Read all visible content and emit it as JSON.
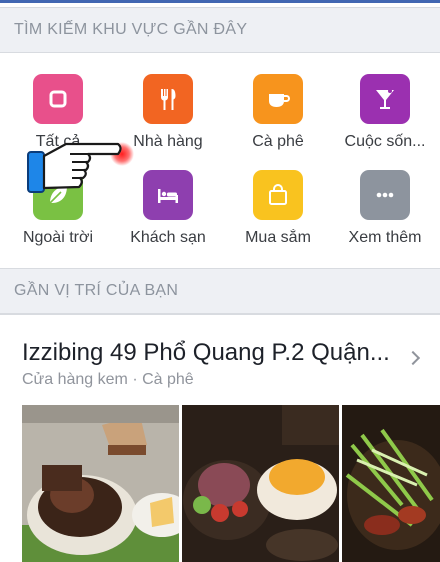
{
  "sections": {
    "nearby_header": "TÌM KIẾM KHU VỰC GẦN ĐÂY",
    "location_header": "GẦN VỊ TRÍ CỦA BẠN"
  },
  "categories": [
    {
      "label": "Tất cả",
      "icon": "all-icon",
      "color": "#e8508b"
    },
    {
      "label": "Nhà hàng",
      "icon": "fork-knife-icon",
      "color": "#f26522"
    },
    {
      "label": "Cà phê",
      "icon": "coffee-cup-icon",
      "color": "#f7941d"
    },
    {
      "label": "Cuộc sốn...",
      "icon": "cocktail-icon",
      "color": "#9b30b0"
    },
    {
      "label": "Ngoài trời",
      "icon": "leaf-icon",
      "color": "#7ac143"
    },
    {
      "label": "Khách sạn",
      "icon": "bed-icon",
      "color": "#8e3faf"
    },
    {
      "label": "Mua sắm",
      "icon": "shopping-bag-icon",
      "color": "#f9c31f"
    },
    {
      "label": "Xem thêm",
      "icon": "more-dots-icon",
      "color": "#8d949e"
    }
  ],
  "place": {
    "name": "Izzibing 49 Phổ Quang P.2 Quận...",
    "subtitle": "Cửa hàng kem · Cà phê"
  },
  "overlay": {
    "pointer": "pointing-hand-icon",
    "highlight_color": "#ff0000"
  }
}
